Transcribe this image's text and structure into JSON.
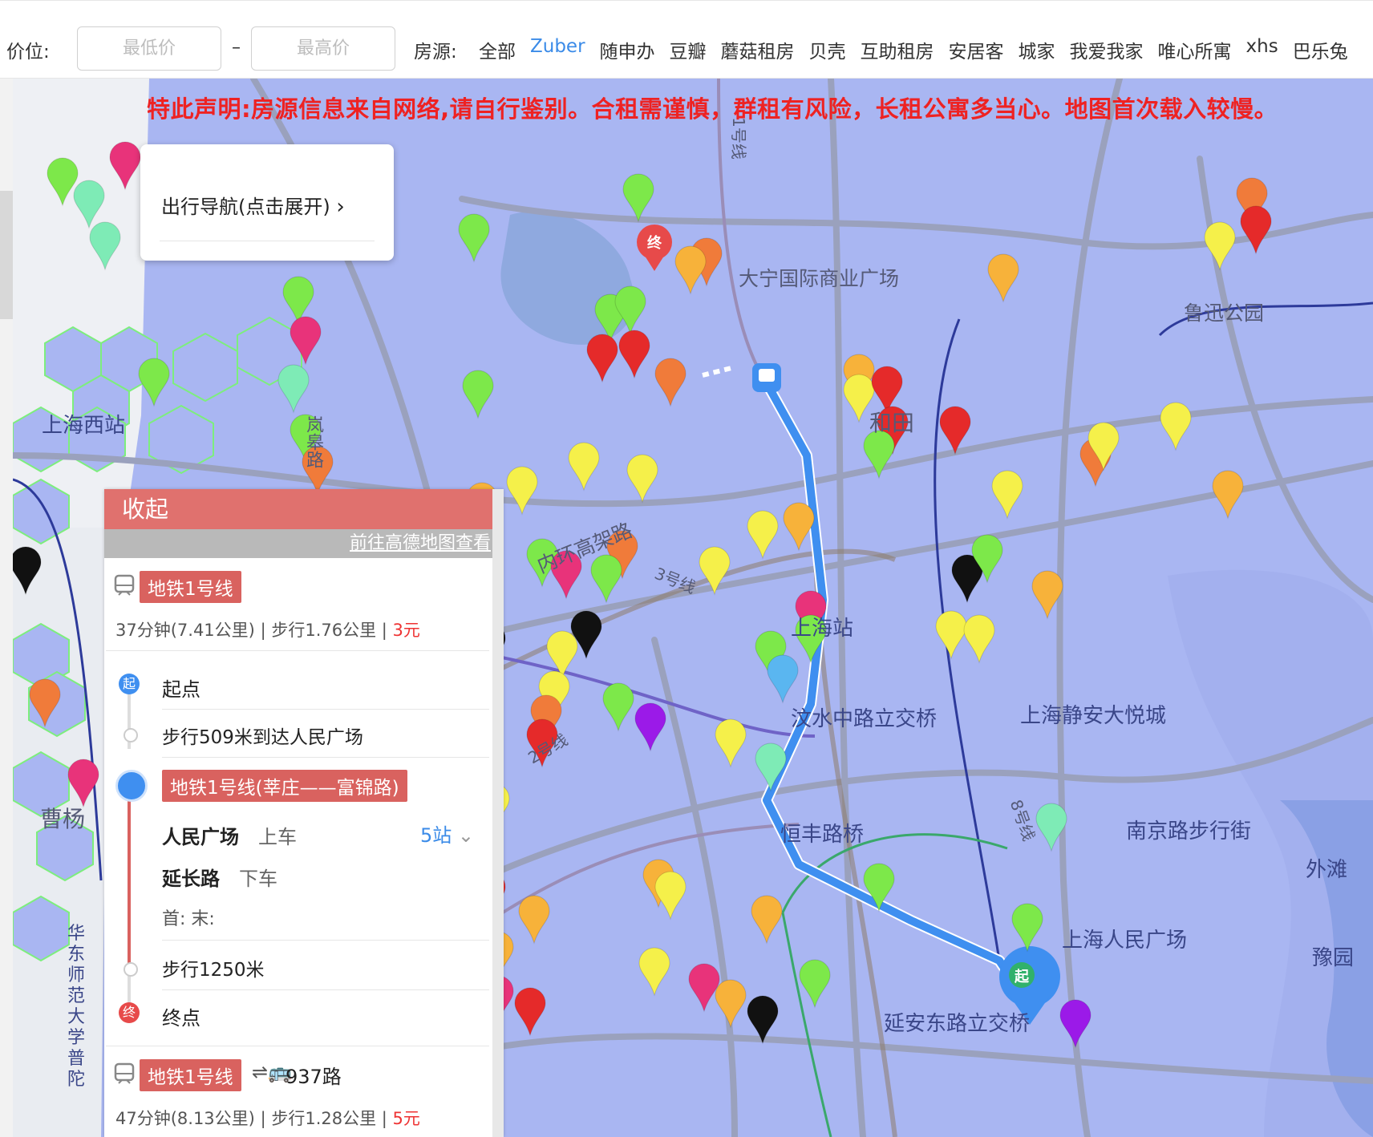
{
  "filters": {
    "price_label": "价位:",
    "min_placeholder": "最低价",
    "max_placeholder": "最高价",
    "dash": "–",
    "source_label": "房源:",
    "sources": [
      "全部",
      "Zuber",
      "随申办",
      "豆瓣",
      "蘑菇租房",
      "贝壳",
      "互助租房",
      "安居客",
      "城家",
      "我爱我家",
      "唯心所寓",
      "xhs",
      "巴乐兔"
    ],
    "active_source": "Zuber",
    "accent": "#3b8be8"
  },
  "notice": "特此声明:房源信息来自网络,请自行鉴别。合租需谨慎，群租有风险，长租公寓多当心。地图首次载入较慢。",
  "nav_popover": {
    "label": "出行导航(点击展开)",
    "chevron": "chevron-right-icon"
  },
  "map_labels": {
    "daning": "大宁国际商业广场",
    "luxun": "鲁迅公园",
    "shanghai_west": "上海西站",
    "hetian": "和田",
    "caoyang": "曹杨",
    "hengfeng": "恒丰路桥",
    "zhongshan": "汶水中路立交桥",
    "jingan": "上海静安大悦城",
    "nanjing": "南京路步行街",
    "bund": "外滩",
    "renmin": "上海人民广场",
    "yuyuan": "豫园",
    "yanan": "延安东路立交桥",
    "inner_ring": "内环高架路",
    "line1": "1号线",
    "line3": "3号线",
    "line8": "8号线",
    "line2": "2号线",
    "shanghai_station": "上海站",
    "lan": "岚皋路",
    "huadong": "华东师范大学普陀",
    "end_marker": "终",
    "start_marker": "起"
  },
  "route_panel": {
    "collapse": "收起",
    "view_amap": "前往高德地图查看",
    "option1": {
      "line": "地铁1号线",
      "duration": "37分钟(7.41公里)",
      "walk": "步行1.76公里",
      "fare": "3元",
      "divider": "|"
    },
    "steps": {
      "start": "起点",
      "walk1": "步行509米到达人民广场",
      "line_full": "地铁1号线(莘庄——富锦路)",
      "board_station": "人民广场",
      "board": "上车",
      "stops": "5站",
      "alight_station": "延长路",
      "alight": "下车",
      "first_last": "首: 末:",
      "walk2": "步行1250米",
      "end": "终点",
      "start_badge": "起",
      "end_badge": "终"
    },
    "option2": {
      "line": "地铁1号线",
      "bus": "937路",
      "duration": "47分钟(8.13公里)",
      "walk": "步行1.28公里",
      "fare": "5元",
      "divider": "|"
    }
  }
}
